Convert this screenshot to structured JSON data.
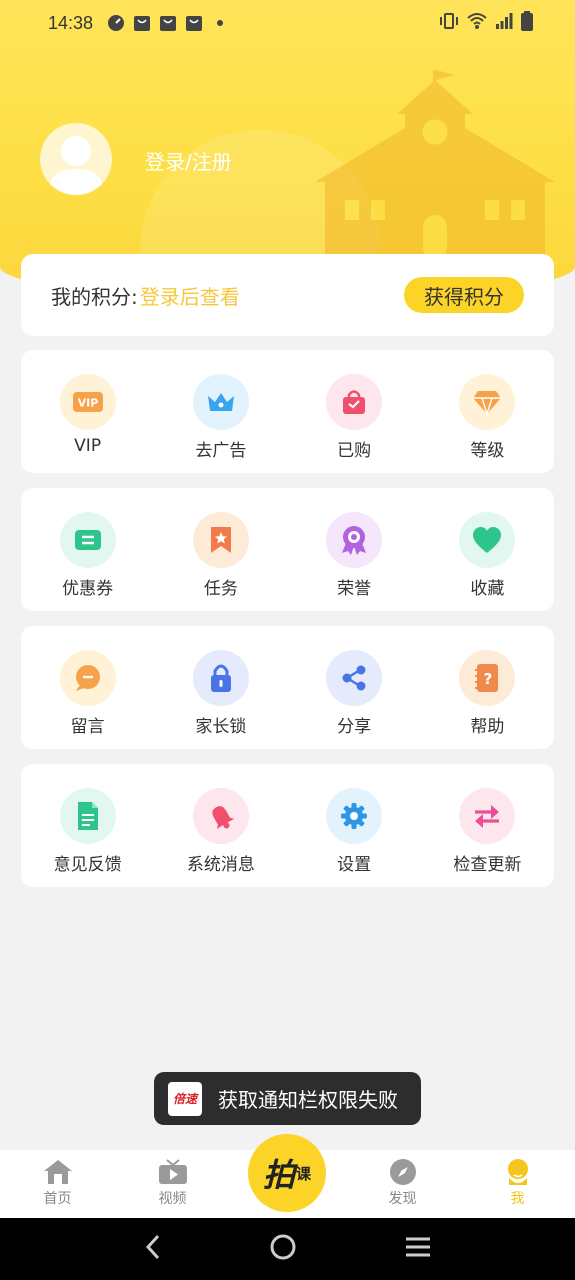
{
  "status_bar": {
    "time": "14:38"
  },
  "header": {
    "login_text": "登录/注册"
  },
  "points": {
    "label": "我的积分:",
    "value": "登录后查看",
    "button": "获得积分"
  },
  "menu_rows": [
    [
      {
        "label": "VIP",
        "icon": "vip-icon"
      },
      {
        "label": "去广告",
        "icon": "crown-icon"
      },
      {
        "label": "已购",
        "icon": "shopping-bag-icon"
      },
      {
        "label": "等级",
        "icon": "diamond-icon"
      }
    ],
    [
      {
        "label": "优惠券",
        "icon": "coupon-icon"
      },
      {
        "label": "任务",
        "icon": "bookmark-star-icon"
      },
      {
        "label": "荣誉",
        "icon": "medal-icon"
      },
      {
        "label": "收藏",
        "icon": "heart-icon"
      }
    ],
    [
      {
        "label": "留言",
        "icon": "message-icon"
      },
      {
        "label": "家长锁",
        "icon": "lock-icon"
      },
      {
        "label": "分享",
        "icon": "share-icon"
      },
      {
        "label": "帮助",
        "icon": "help-book-icon"
      }
    ],
    [
      {
        "label": "意见反馈",
        "icon": "document-icon"
      },
      {
        "label": "系统消息",
        "icon": "bell-icon"
      },
      {
        "label": "设置",
        "icon": "gear-icon"
      },
      {
        "label": "检查更新",
        "icon": "refresh-arrows-icon"
      }
    ]
  ],
  "toast": {
    "logo_text": "倍速",
    "text": "获取通知栏权限失败"
  },
  "tabbar": {
    "home": "首页",
    "video": "视频",
    "center_logo": "拍",
    "center_logo_sub": "课",
    "discover": "发现",
    "me": "我"
  },
  "colors": {
    "accent": "#fbd427",
    "active_tab": "#f5c51f",
    "points_value": "#f6c83a"
  }
}
